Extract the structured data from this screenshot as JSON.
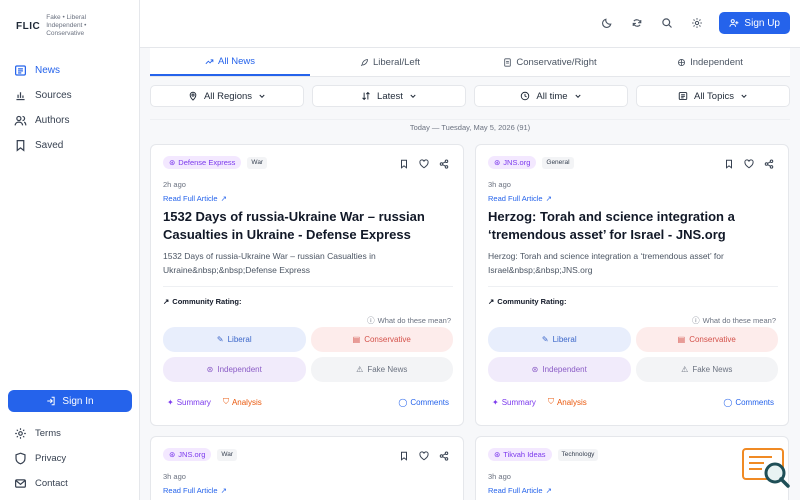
{
  "app": {
    "logo": "FLIC",
    "logo_tagline": "Fake • Liberal Independent • Conservative"
  },
  "sidebar": {
    "items": [
      {
        "label": "News",
        "icon": "newspaper-icon",
        "active": true
      },
      {
        "label": "Sources",
        "icon": "bar-chart-icon"
      },
      {
        "label": "Authors",
        "icon": "users-icon"
      },
      {
        "label": "Saved",
        "icon": "bookmark-icon"
      }
    ],
    "signin_label": "Sign In",
    "footer": [
      {
        "label": "Terms",
        "icon": "gear-icon"
      },
      {
        "label": "Privacy",
        "icon": "shield-icon"
      },
      {
        "label": "Contact",
        "icon": "mail-icon"
      }
    ]
  },
  "header": {
    "signup_label": "Sign Up"
  },
  "tabs": [
    {
      "label": "All News",
      "active": true
    },
    {
      "label": "Liberal/Left"
    },
    {
      "label": "Conservative/Right"
    },
    {
      "label": "Independent"
    }
  ],
  "filters": {
    "region": "All Regions",
    "sort": "Latest",
    "time": "All time",
    "topics": "All Topics"
  },
  "date_line": "Today — Tuesday, May 5, 2026 (91)",
  "labels": {
    "read_full": "Read Full Article",
    "community_rating": "Community Rating:",
    "what_mean": "What do these mean?",
    "liberal": "Liberal",
    "conservative": "Conservative",
    "independent": "Independent",
    "fake_news": "Fake News",
    "summary": "Summary",
    "analysis": "Analysis",
    "comments": "Comments"
  },
  "cards": [
    {
      "source": "Defense Express",
      "category": "War",
      "ago": "2h ago",
      "title": "1532 Days of russia-Ukraine War – russian Casualties in Ukraine - Defense Express",
      "desc": "1532 Days of russia-Ukraine War – russian Casualties in Ukraine&nbsp;&nbsp;Defense Express"
    },
    {
      "source": "JNS.org",
      "category": "General",
      "ago": "3h ago",
      "title": "Herzog: Torah and science integration a ‘tremendous asset’ for Israel - JNS.org",
      "desc": "Herzog: Torah and science integration a ‘tremendous asset’ for Israel&nbsp;&nbsp;JNS.org"
    },
    {
      "source": "JNS.org",
      "category": "War",
      "ago": "3h ago"
    },
    {
      "source": "Tikvah Ideas",
      "category": "Technology",
      "ago": "3h ago"
    }
  ],
  "colors": {
    "accent": "#2563eb",
    "liberal": "#3b66c9",
    "conservative": "#d4514a",
    "independent": "#8b5cc6",
    "summary": "#7c3aed",
    "analysis": "#ea580c"
  }
}
